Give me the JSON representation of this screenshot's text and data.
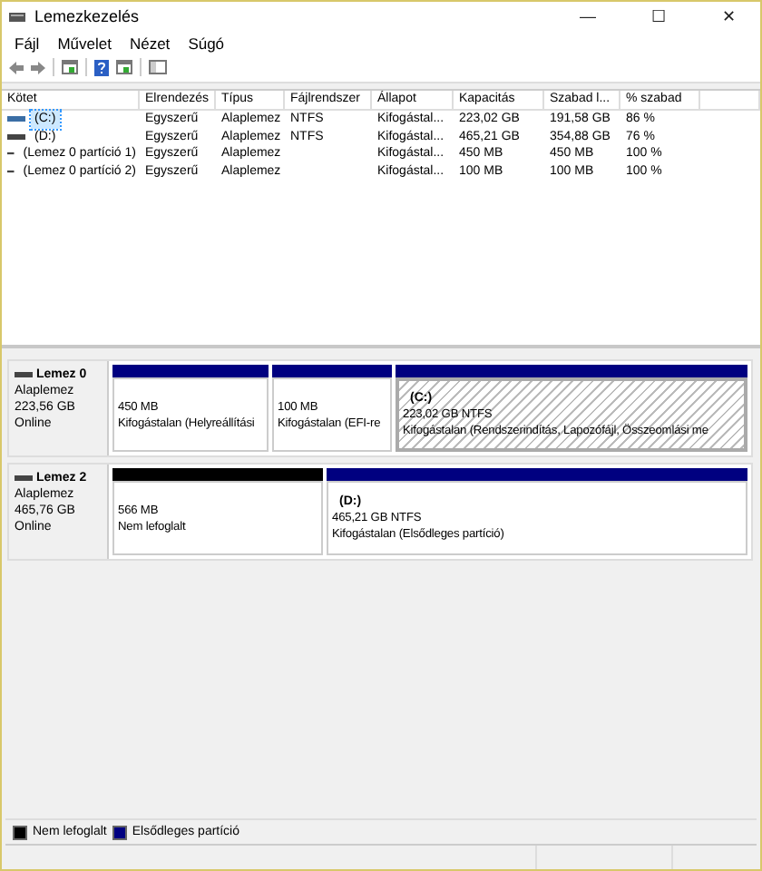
{
  "window": {
    "title": "Lemezkezelés",
    "controls": [
      "—",
      "☐",
      "✕"
    ]
  },
  "menu": [
    "Fájl",
    "Művelet",
    "Nézet",
    "Súgó"
  ],
  "table": {
    "columns": [
      "Kötet",
      "Elrendezés",
      "Típus",
      "Fájlrendszer",
      "Állapot",
      "Kapacitás",
      "Szabad l...",
      "% szabad"
    ],
    "rows": [
      {
        "cells": [
          "(C:)",
          "Egyszerű",
          "Alaplemez",
          "NTFS",
          "Kifogástal...",
          "223,02 GB",
          "191,58 GB",
          "86 %"
        ],
        "selected": true
      },
      {
        "cells": [
          "(D:)",
          "Egyszerű",
          "Alaplemez",
          "NTFS",
          "Kifogástal...",
          "465,21 GB",
          "354,88 GB",
          "76 %"
        ],
        "selected": false
      },
      {
        "cells": [
          "(Lemez 0 partíció 1)",
          "Egyszerű",
          "Alaplemez",
          "",
          "Kifogástal...",
          "450 MB",
          "450 MB",
          "100 %"
        ],
        "selected": false
      },
      {
        "cells": [
          "(Lemez 0 partíció 2)",
          "Egyszerű",
          "Alaplemez",
          "",
          "Kifogástal...",
          "100 MB",
          "100 MB",
          "100 %"
        ],
        "selected": false
      }
    ]
  },
  "disks": [
    {
      "name": "Lemez 0",
      "type": "Alaplemez",
      "size": "223,56 GB",
      "status": "Online",
      "partitions": [
        {
          "kind": "primary",
          "selected": false,
          "size": "450 MB",
          "status": "Kifogástalan (Helyreállítási"
        },
        {
          "kind": "primary",
          "selected": false,
          "size": "100 MB",
          "status": "Kifogástalan (EFI-re"
        },
        {
          "kind": "primary",
          "selected": true,
          "label": "(C:)",
          "size": "223,02 GB NTFS",
          "status": "Kifogástalan (Rendszerindítás, Lapozófájl, Összeomlási me"
        }
      ]
    },
    {
      "name": "Lemez 2",
      "type": "Alaplemez",
      "size": "465,76 GB",
      "status": "Online",
      "partitions": [
        {
          "kind": "unallocated",
          "selected": false,
          "size": "566 MB",
          "status": "Nem lefoglalt"
        },
        {
          "kind": "primary",
          "selected": false,
          "label": "(D:)",
          "size": "465,21 GB NTFS",
          "status": "Kifogástalan (Elsődleges partíció)"
        }
      ]
    }
  ],
  "legend": [
    {
      "label": "Nem lefoglalt",
      "color": "#000000"
    },
    {
      "label": "Elsődleges partíció",
      "color": "#000080"
    }
  ]
}
